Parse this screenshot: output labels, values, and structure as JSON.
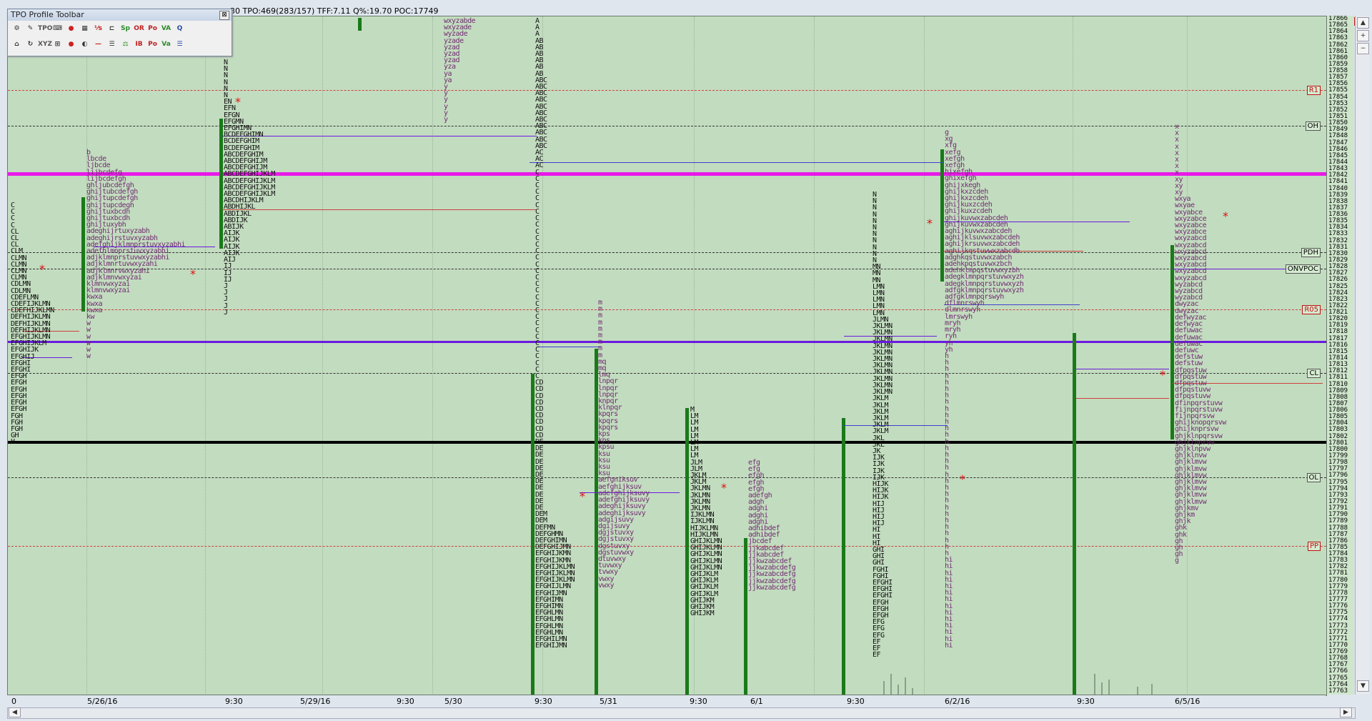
{
  "header": {
    "info": "30 TPO:469(283/157) TFF:7.11 Q%:19.70 POC:17749",
    "sub": "me"
  },
  "toolbar": {
    "title": "TPO Profile Toolbar",
    "close": "⊠",
    "row1": [
      "⚙",
      "✎",
      "TPO",
      "⌨",
      "●",
      "▦",
      "⅟s",
      "⊏",
      "Sp",
      "OR",
      "Po",
      "VA",
      "Q"
    ],
    "row2": [
      "⌂",
      "↻",
      "XYZ",
      "⊞",
      "●",
      "◐",
      "—",
      "☰",
      "⚖",
      "IB",
      "Po",
      "Va",
      "☰"
    ]
  },
  "close_button": "×",
  "price_axis": {
    "ticks": [
      "17866",
      "17865",
      "17864",
      "17863",
      "17862",
      "17861",
      "17860",
      "17859",
      "17858",
      "17857",
      "17856",
      "17855",
      "17854",
      "17853",
      "17852",
      "17851",
      "17850",
      "17849",
      "17848",
      "17847",
      "17846",
      "17845",
      "17844",
      "17843",
      "17842",
      "17841",
      "17840",
      "17839",
      "17838",
      "17837",
      "17836",
      "17835",
      "17834",
      "17833",
      "17832",
      "17831",
      "17830",
      "17829",
      "17828",
      "17827",
      "17826",
      "17825",
      "17824",
      "17823",
      "17822",
      "17821",
      "17820",
      "17819",
      "17818",
      "17817",
      "17816",
      "17815",
      "17814",
      "17813",
      "17812",
      "17811",
      "17810",
      "17809",
      "17808",
      "17807",
      "17806",
      "17805",
      "17804",
      "17803",
      "17802",
      "17801",
      "17800",
      "17799",
      "17798",
      "17797",
      "17796",
      "17795",
      "17794",
      "17793",
      "17792",
      "17791",
      "17790",
      "17789",
      "17788",
      "17787",
      "17786",
      "17785",
      "17784",
      "17783",
      "17782",
      "17781",
      "17780",
      "17779",
      "17778",
      "17777",
      "17776",
      "17775",
      "17774",
      "17773",
      "17772",
      "17771",
      "17770",
      "17769",
      "17768",
      "17767",
      "17766",
      "17765",
      "17764",
      "17763"
    ]
  },
  "levels": [
    {
      "label": "R1",
      "red": true
    },
    {
      "label": "OH",
      "red": false
    },
    {
      "label": "PDH",
      "red": false
    },
    {
      "label": "ONVPOC",
      "red": false
    },
    {
      "label": "R05",
      "red": true
    },
    {
      "label": "CL",
      "red": false
    },
    {
      "label": "OL",
      "red": false
    },
    {
      "label": "PP",
      "red": true
    }
  ],
  "time_axis": [
    "0",
    "5/26/16",
    "9:30",
    "5/29/16",
    "9:30",
    "5/30",
    "9:30",
    "5/31",
    "9:30",
    "6/1",
    "9:30",
    "6/2/16",
    "9:30",
    "6/5/16"
  ],
  "scroll": {
    "up": "▲",
    "down": "▼",
    "plus": "+",
    "minus": "−",
    "left": "◀",
    "right": "▶"
  },
  "profiles": {
    "p1": "C\nC\nC\nC\nCL\nCL\nCL\nCLM\nCLMN\nCLMN\nCLMN\nCLMN\nCDLMN\nCDLMN\nCDEFLMN\nCDEFIJKLMN\nCDEFHIJKLMN\nDEFHIJKLMN\nDEFHIJKLMN\nDEFHIJKLMN\nEFGHIJKLMN\nEFGHIJKLM\nEFGHIJK\nEFGHIJ\nEFGHI\nEFGHI\nEFGH\nEFGH\nEFGH\nEFGH\nEFGH\nEFGH\nFGH\nFGH\nFGH\nGH\nH",
    "p2": "b\nlbcde\nljbcde\nlijbcdefg\nlijbcdefgh\nghljubcdefgh\nghijtubcdefgh\nghijtupcdefgh\nghijtupcdegh\nghijtuxbcdh\nghijtuxbcdh\nghijtuxybh\nadeghijrtuxyzabh\nadeghijrstuvxyzabh\nadefghijklmnprstuvxyzabhi\nadefhlmnprstuvxyzabhi\nadjklmnprstuvwxyzabhi\nadjklmnrtuvwxyzahi\nadjklmnrvwxyzahi\nadjklmnvwxyzai\nklmnvwxyzai\nklmnvwxyzai\nkwxa\nkwxa\nkwxa\nkw\nw\nw\nw\nw\nw\nw",
    "p3": "N\nN\nN\nN\nN\nN\nEN\nEFN\nEFGN\nEFGMN\nEFGHIMN\nBCDEFGHIMN\nBCDEFGHIM\nBCDEFGHIM\nABCDEFGHIM\nABCDEFGHIJM\nABCDEFGHIJM\nABCDEFGHIJKLM\nABCDEFGHIJKLM\nABCDEFGHIJKLM\nABCDEFGHIJKLM\nABCDHIJKLM\nABDHIJKL\nABDIJKL\nABDIJK\nABIJK\nAIJK\nAIJK\nAIJK\nAIJK\nAIJ\nIJ\nIJ\nIJ\nJ\nJ\nJ\nJ\nJ",
    "p4": "wxyzabde\nwxyzade\nwyzade\nyzade\nyzad\nyzad\nyzad\nyza\nya\nya\ny\ny\ny\ny\ny\ny",
    "p5": "A\nA\nA\nAB\nAB\nAB\nAB\nAB\nAB\nABC\nABC\nABC\nABC\nABC\nABC\nABC\nABC\nABC\nABC\nABC\nAC\nAC\nAC\nC\nC\nC\nC\nC\nC\nC\nC\nC\nC\nC\nC\nC\nC\nC\nC\nC\nC\nC\nC\nC\nC\nC\nC\nC\nC\nC\nC\nC\nC\nC\nC\nCD\nCD\nCD\nCD\nCD\nCD\nCD\nCD\nCD\nDE\nDE\nDE\nDE\nDE\nDE\nDE\nDE\nDE\nDE\nDE\nDEM\nDEM\nDEFMN\nDEFGHMN\nDEFGHIMN\nDEFGHIJMN\nEFGHIJKMN\nEFGHIJKMN\nEFGHIJKLMN\nEFGHIJKLMN\nEFGHIJKLMN\nEFGHIJLMN\nEFGHIJMN\nEFGHIMN\nEFGHIMN\nEFGHLMN\nEFGHLMN\nEFGHLMN\nEFGHLMN\nEFGHILMN\nEFGHIJMN",
    "p6": "m\nm\nm\nm\nm\nm\nm\nm\nm\nmq\nmq\nlmq\nlnpqr\nlnpqr\nlnpqr\nknpqr\nklnpqr\nkpqrs\nkpqrs\nkpqrs\nkps\nkps\nkpsu\nksu\nksu\nksu\nksu\naefgniksuv\naefghijksuv\nadefghijksuvy\nadefghijksuvy\nadeghijksuvy\nadeghijksuvy\nadgijsuvy\ndgijsuvy\ndgjstuvxy\ndgjstuvxy\ndgstuvxy\ndgstuvwxy\ndtuvwxy\ntuvwxy\ntvwxy\nvwxy\nvwxy",
    "p7": "M\nLM\nLM\nLM\nLM\nLM\nLM\nLM\nJLM\nJLM\nJKLM\nJKLM\nJKLMN\nJKLMN\nJKLMN\nJKLMN\nIJKLMN\nIJKLMN\nHIJKLMN\nHIJKLMN\nGHIJKLMN\nGHIJKLMN\nGHIJKLMN\nGHIJKLMN\nGHIJKLMN\nGHIJKLM\nGHIJKLM\nGHIJKLM\nGHIJKLM\nGHIJKM\nGHIJKM\nGHIJKM",
    "p8": "efg\nefg\nefgh\nefgh\nefgh\nadefgh\nadgh\nadghi\nadghi\nadghi\nadhibdef\nadhibdef\njbcdef\njjkabcdef\njjkabcdef\njjkwzabcdef\njjkwzabcdefg\njjkwzabcdefg\njjkwzabcdefg\njjkwzabcdefg",
    "p9": "N\nN\nN\nN\nN\nN\nN\nN\nN\nN\nN\nMN\nMN\nMN\nLMN\nLMN\nLMN\nLMN\nLMN\nJLMN\nJKLMN\nJKLMN\nJKLMN\nJKLMN\nJKLMN\nJKLMN\nJKLMN\nJKLMN\nJKLMN\nJKLMN\nJKLMN\nJKLM\nJKLM\nJKLM\nJKLM\nJKLM\nJKLM\nJKL\nJKL\nJK\nIJK\nIJK\nIJK\nIJK\nHIJK\nHIJK\nHIJK\nHIJ\nHIJ\nHIJ\nHIJ\nHI\nHI\nHI\nGHI\nGHI\nGHI\nFGHI\nFGHI\nEFGHI\nEFGHI\nEFGHI\nEFGH\nEFGH\nEFGH\nEFG\nEFG\nEFG\nEF\nEF\nEF",
    "p10": "g\nxg\nxfg\nxefg\nxefgh\nxefgh\nhixefgh\nghixefgh\nghijxkegh\nghijkxzcdeh\nghijkxzcdeh\nghijkuxzcdeh\nghijkuxzcdeh\nghijkuvwxzabcdeh\nghijkuvwxzabcdeh\naghijkuvwxzabcdeh\naghijklsuvwxzabcdeh\naghijkrsuvwxzabcdeh\naghijkqstuvwxzabcdh\nadghkqstuvwxzabch\nadehkpqstuvwxzbch\nadehklmpqstuvwxyzbh\nadegklmnpqrstuvwxyzh\nadegklmnpqrstuvwxyzh\nadfgklmnpqrstuvwxyzh\nadfgklmnpqrswyh\ndflmnrswyh\ndlmnrswyh\nlmrswyh\nmryh\nmryh\nryh\nyh\nyh\nh\nh\nh\nh\nh\nh\nh\nh\nh\nh\nh\nh\nh\nh\nh\nh\nh\nh\nh\nh\nh\nh\nh\nh\nh\nh\nh\nh\nh\nh\nh\nhi\nhi\nhi\nhi\nhi\nhi\nhi\nhi\nhi\nhi\nhi\nhi\nhi\nhi",
    "p11": "x\nx\nx\nx\nx\nx\nx\nx\nxy\nxy\nxy\nwxya\nwxyae\nwxyabce\nwxyzabce\nwxyzabce\nwxyzabce\nwxyzabcd\nwxyzabcd\nwxyzabcd\nwxyzabcd\nwxyzabcd\nwxyzabcd\nwxyzabcd\nwyzabcd\nwyzabcd\nwyzabcd\ndwyzac\ndwyzac\ndefwyzac\ndefwyac\ndefuwac\ndefuwac\ndefuwac\ndefuwc\ndefstuw\ndefstuw\ndfpqstuw\ndfpqstuw\ndfpqstuw\ndfpqstuvw\ndfpqstuvw\ndfinpqrstuvw\nfijnpqrstuvw\nfijnpqrsvw\nghijknopqrsvw\nghijknprsvw\nghjklnpqrsvw\nghjklnprvw\nghjklnpvw\nghjklnvw\nghjklmvw\nghjklmvw\nghjklmvw\nghjklmvw\nghjklmvw\nghjklmvw\nghjklmvw\nghjkmv\nghjkm\nghjk\nghk\nghk\ngh\ngh\ngh\ng"
  }
}
